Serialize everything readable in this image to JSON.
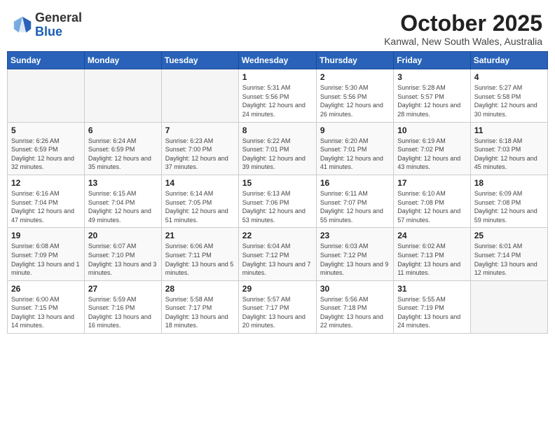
{
  "header": {
    "logo_general": "General",
    "logo_blue": "Blue",
    "month": "October 2025",
    "location": "Kanwal, New South Wales, Australia"
  },
  "weekdays": [
    "Sunday",
    "Monday",
    "Tuesday",
    "Wednesday",
    "Thursday",
    "Friday",
    "Saturday"
  ],
  "weeks": [
    [
      {
        "day": null
      },
      {
        "day": null
      },
      {
        "day": null
      },
      {
        "day": "1",
        "sunrise": "5:31 AM",
        "sunset": "5:56 PM",
        "daylight": "12 hours and 24 minutes."
      },
      {
        "day": "2",
        "sunrise": "5:30 AM",
        "sunset": "5:56 PM",
        "daylight": "12 hours and 26 minutes."
      },
      {
        "day": "3",
        "sunrise": "5:28 AM",
        "sunset": "5:57 PM",
        "daylight": "12 hours and 28 minutes."
      },
      {
        "day": "4",
        "sunrise": "5:27 AM",
        "sunset": "5:58 PM",
        "daylight": "12 hours and 30 minutes."
      }
    ],
    [
      {
        "day": "5",
        "sunrise": "6:26 AM",
        "sunset": "6:59 PM",
        "daylight": "12 hours and 32 minutes."
      },
      {
        "day": "6",
        "sunrise": "6:24 AM",
        "sunset": "6:59 PM",
        "daylight": "12 hours and 35 minutes."
      },
      {
        "day": "7",
        "sunrise": "6:23 AM",
        "sunset": "7:00 PM",
        "daylight": "12 hours and 37 minutes."
      },
      {
        "day": "8",
        "sunrise": "6:22 AM",
        "sunset": "7:01 PM",
        "daylight": "12 hours and 39 minutes."
      },
      {
        "day": "9",
        "sunrise": "6:20 AM",
        "sunset": "7:01 PM",
        "daylight": "12 hours and 41 minutes."
      },
      {
        "day": "10",
        "sunrise": "6:19 AM",
        "sunset": "7:02 PM",
        "daylight": "12 hours and 43 minutes."
      },
      {
        "day": "11",
        "sunrise": "6:18 AM",
        "sunset": "7:03 PM",
        "daylight": "12 hours and 45 minutes."
      }
    ],
    [
      {
        "day": "12",
        "sunrise": "6:16 AM",
        "sunset": "7:04 PM",
        "daylight": "12 hours and 47 minutes."
      },
      {
        "day": "13",
        "sunrise": "6:15 AM",
        "sunset": "7:04 PM",
        "daylight": "12 hours and 49 minutes."
      },
      {
        "day": "14",
        "sunrise": "6:14 AM",
        "sunset": "7:05 PM",
        "daylight": "12 hours and 51 minutes."
      },
      {
        "day": "15",
        "sunrise": "6:13 AM",
        "sunset": "7:06 PM",
        "daylight": "12 hours and 53 minutes."
      },
      {
        "day": "16",
        "sunrise": "6:11 AM",
        "sunset": "7:07 PM",
        "daylight": "12 hours and 55 minutes."
      },
      {
        "day": "17",
        "sunrise": "6:10 AM",
        "sunset": "7:08 PM",
        "daylight": "12 hours and 57 minutes."
      },
      {
        "day": "18",
        "sunrise": "6:09 AM",
        "sunset": "7:08 PM",
        "daylight": "12 hours and 59 minutes."
      }
    ],
    [
      {
        "day": "19",
        "sunrise": "6:08 AM",
        "sunset": "7:09 PM",
        "daylight": "13 hours and 1 minute."
      },
      {
        "day": "20",
        "sunrise": "6:07 AM",
        "sunset": "7:10 PM",
        "daylight": "13 hours and 3 minutes."
      },
      {
        "day": "21",
        "sunrise": "6:06 AM",
        "sunset": "7:11 PM",
        "daylight": "13 hours and 5 minutes."
      },
      {
        "day": "22",
        "sunrise": "6:04 AM",
        "sunset": "7:12 PM",
        "daylight": "13 hours and 7 minutes."
      },
      {
        "day": "23",
        "sunrise": "6:03 AM",
        "sunset": "7:12 PM",
        "daylight": "13 hours and 9 minutes."
      },
      {
        "day": "24",
        "sunrise": "6:02 AM",
        "sunset": "7:13 PM",
        "daylight": "13 hours and 11 minutes."
      },
      {
        "day": "25",
        "sunrise": "6:01 AM",
        "sunset": "7:14 PM",
        "daylight": "13 hours and 12 minutes."
      }
    ],
    [
      {
        "day": "26",
        "sunrise": "6:00 AM",
        "sunset": "7:15 PM",
        "daylight": "13 hours and 14 minutes."
      },
      {
        "day": "27",
        "sunrise": "5:59 AM",
        "sunset": "7:16 PM",
        "daylight": "13 hours and 16 minutes."
      },
      {
        "day": "28",
        "sunrise": "5:58 AM",
        "sunset": "7:17 PM",
        "daylight": "13 hours and 18 minutes."
      },
      {
        "day": "29",
        "sunrise": "5:57 AM",
        "sunset": "7:17 PM",
        "daylight": "13 hours and 20 minutes."
      },
      {
        "day": "30",
        "sunrise": "5:56 AM",
        "sunset": "7:18 PM",
        "daylight": "13 hours and 22 minutes."
      },
      {
        "day": "31",
        "sunrise": "5:55 AM",
        "sunset": "7:19 PM",
        "daylight": "13 hours and 24 minutes."
      },
      {
        "day": null
      }
    ]
  ],
  "labels": {
    "sunrise_prefix": "Sunrise: ",
    "sunset_prefix": "Sunset: ",
    "daylight_prefix": "Daylight: "
  }
}
